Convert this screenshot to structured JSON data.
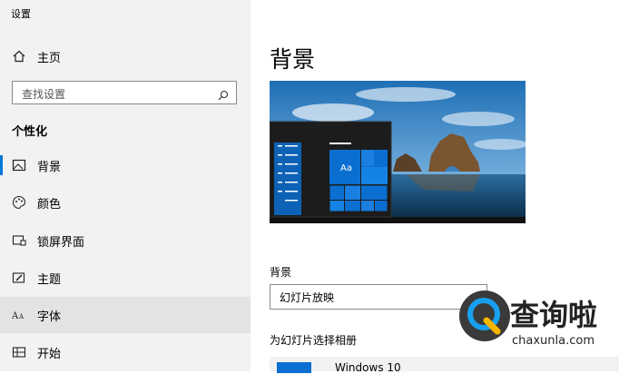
{
  "window": {
    "title": "设置"
  },
  "sidebar": {
    "home_label": "主页",
    "search_placeholder": "查找设置",
    "section_title": "个性化",
    "items": [
      {
        "label": "背景",
        "icon": "image-icon"
      },
      {
        "label": "颜色",
        "icon": "palette-icon"
      },
      {
        "label": "锁屏界面",
        "icon": "lock-screen-icon"
      },
      {
        "label": "主题",
        "icon": "theme-icon"
      },
      {
        "label": "字体",
        "icon": "font-icon"
      },
      {
        "label": "开始",
        "icon": "start-icon"
      }
    ],
    "selected_item": "背景",
    "hovered_item": "字体"
  },
  "main": {
    "title": "背景",
    "preview": {
      "tile_label": "Aa"
    },
    "background_label": "背景",
    "background_value": "幻灯片放映",
    "album_label": "为幻灯片选择相册",
    "album_selected": "Windows 10"
  },
  "watermark": {
    "title": "查询啦",
    "url": "chaxunla.com"
  },
  "colors": {
    "accent": "#0078d7",
    "sidebar_bg": "#f2f2f2",
    "hover_bg": "#e3e3e3"
  }
}
